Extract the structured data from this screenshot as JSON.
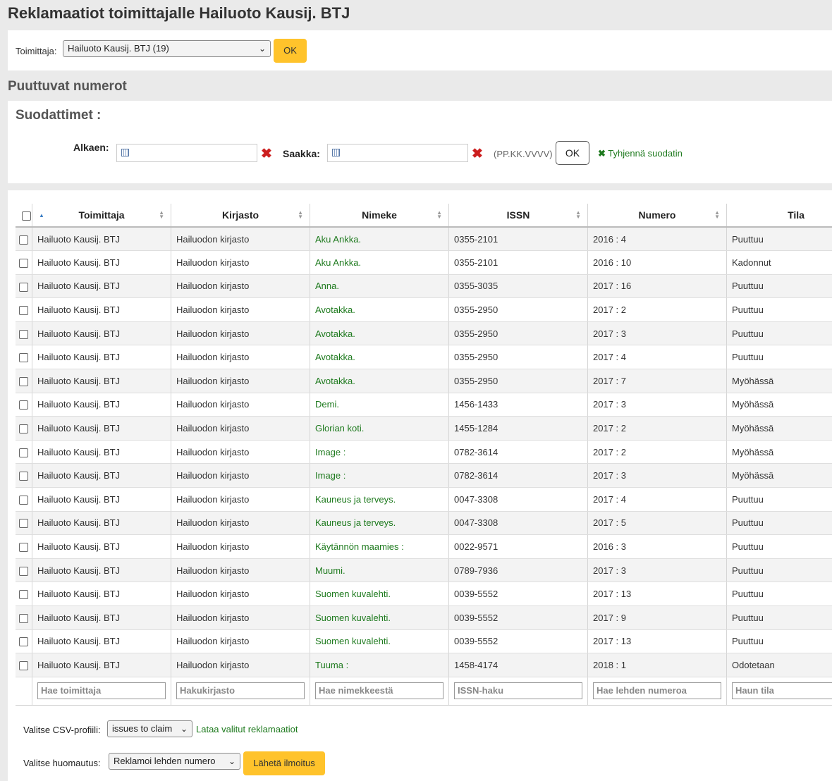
{
  "page_title": "Reklamaatiot toimittajalle Hailuoto Kausij. BTJ",
  "vendor_select": {
    "label": "Toimittaja:",
    "value": "Hailuoto Kausij. BTJ (19)",
    "ok": "OK"
  },
  "section_title": "Puuttuvat numerot",
  "filters": {
    "title": "Suodattimet :",
    "from_label": "Alkaen:",
    "to_label": "Saakka:",
    "format_hint": "(PP.KK.VVVV)",
    "ok": "OK",
    "clear": "Tyhjennä suodatin"
  },
  "table": {
    "headers": [
      "Toimittaja",
      "Kirjasto",
      "Nimeke",
      "ISSN",
      "Numero",
      "Tila"
    ],
    "rows": [
      {
        "vendor": "Hailuoto Kausij. BTJ",
        "library": "Hailuodon kirjasto",
        "title": "Aku Ankka.",
        "issn": "0355-2101",
        "issue": "2016 : 4",
        "status": "Puuttuu"
      },
      {
        "vendor": "Hailuoto Kausij. BTJ",
        "library": "Hailuodon kirjasto",
        "title": "Aku Ankka.",
        "issn": "0355-2101",
        "issue": "2016 : 10",
        "status": "Kadonnut"
      },
      {
        "vendor": "Hailuoto Kausij. BTJ",
        "library": "Hailuodon kirjasto",
        "title": "Anna.",
        "issn": "0355-3035",
        "issue": "2017 : 16",
        "status": "Puuttuu"
      },
      {
        "vendor": "Hailuoto Kausij. BTJ",
        "library": "Hailuodon kirjasto",
        "title": "Avotakka.",
        "issn": "0355-2950",
        "issue": "2017 : 2",
        "status": "Puuttuu"
      },
      {
        "vendor": "Hailuoto Kausij. BTJ",
        "library": "Hailuodon kirjasto",
        "title": "Avotakka.",
        "issn": "0355-2950",
        "issue": "2017 : 3",
        "status": "Puuttuu"
      },
      {
        "vendor": "Hailuoto Kausij. BTJ",
        "library": "Hailuodon kirjasto",
        "title": "Avotakka.",
        "issn": "0355-2950",
        "issue": "2017 : 4",
        "status": "Puuttuu"
      },
      {
        "vendor": "Hailuoto Kausij. BTJ",
        "library": "Hailuodon kirjasto",
        "title": "Avotakka.",
        "issn": "0355-2950",
        "issue": "2017 : 7",
        "status": "Myöhässä"
      },
      {
        "vendor": "Hailuoto Kausij. BTJ",
        "library": "Hailuodon kirjasto",
        "title": "Demi.",
        "issn": "1456-1433",
        "issue": "2017 : 3",
        "status": "Myöhässä"
      },
      {
        "vendor": "Hailuoto Kausij. BTJ",
        "library": "Hailuodon kirjasto",
        "title": "Glorian koti.",
        "issn": "1455-1284",
        "issue": "2017 : 2",
        "status": "Myöhässä"
      },
      {
        "vendor": "Hailuoto Kausij. BTJ",
        "library": "Hailuodon kirjasto",
        "title": "Image :",
        "issn": "0782-3614",
        "issue": "2017 : 2",
        "status": "Myöhässä"
      },
      {
        "vendor": "Hailuoto Kausij. BTJ",
        "library": "Hailuodon kirjasto",
        "title": "Image :",
        "issn": "0782-3614",
        "issue": "2017 : 3",
        "status": "Myöhässä"
      },
      {
        "vendor": "Hailuoto Kausij. BTJ",
        "library": "Hailuodon kirjasto",
        "title": "Kauneus ja terveys.",
        "issn": "0047-3308",
        "issue": "2017 : 4",
        "status": "Puuttuu"
      },
      {
        "vendor": "Hailuoto Kausij. BTJ",
        "library": "Hailuodon kirjasto",
        "title": "Kauneus ja terveys.",
        "issn": "0047-3308",
        "issue": "2017 : 5",
        "status": "Puuttuu"
      },
      {
        "vendor": "Hailuoto Kausij. BTJ",
        "library": "Hailuodon kirjasto",
        "title": "Käytännön maamies :",
        "issn": "0022-9571",
        "issue": "2016 : 3",
        "status": "Puuttuu"
      },
      {
        "vendor": "Hailuoto Kausij. BTJ",
        "library": "Hailuodon kirjasto",
        "title": "Muumi.",
        "issn": "0789-7936",
        "issue": "2017 : 3",
        "status": "Puuttuu"
      },
      {
        "vendor": "Hailuoto Kausij. BTJ",
        "library": "Hailuodon kirjasto",
        "title": "Suomen kuvalehti.",
        "issn": "0039-5552",
        "issue": "2017 : 13",
        "status": "Puuttuu"
      },
      {
        "vendor": "Hailuoto Kausij. BTJ",
        "library": "Hailuodon kirjasto",
        "title": "Suomen kuvalehti.",
        "issn": "0039-5552",
        "issue": "2017 : 9",
        "status": "Puuttuu"
      },
      {
        "vendor": "Hailuoto Kausij. BTJ",
        "library": "Hailuodon kirjasto",
        "title": "Suomen kuvalehti.",
        "issn": "0039-5552",
        "issue": "2017 : 13",
        "status": "Puuttuu"
      },
      {
        "vendor": "Hailuoto Kausij. BTJ",
        "library": "Hailuodon kirjasto",
        "title": "Tuuma :",
        "issn": "1458-4174",
        "issue": "2018 : 1",
        "status": "Odotetaan"
      }
    ],
    "footer_placeholders": [
      "Hae toimittaja",
      "Hakukirjasto",
      "Hae nimekkeestä",
      "ISSN-haku",
      "Hae lehden numeroa",
      "Haun tila"
    ]
  },
  "csv": {
    "label": "Valitse CSV-profiili:",
    "value": "issues to claim",
    "download_link": "Lataa valitut reklamaatiot"
  },
  "notice": {
    "label": "Valitse huomautus:",
    "value": "Reklamoi lehden numero",
    "send": "Lähetä ilmoitus"
  },
  "colors": {
    "accent_button": "#ffc32b",
    "link_green": "#1e7a1e",
    "clear_red": "#cc1e1e"
  }
}
